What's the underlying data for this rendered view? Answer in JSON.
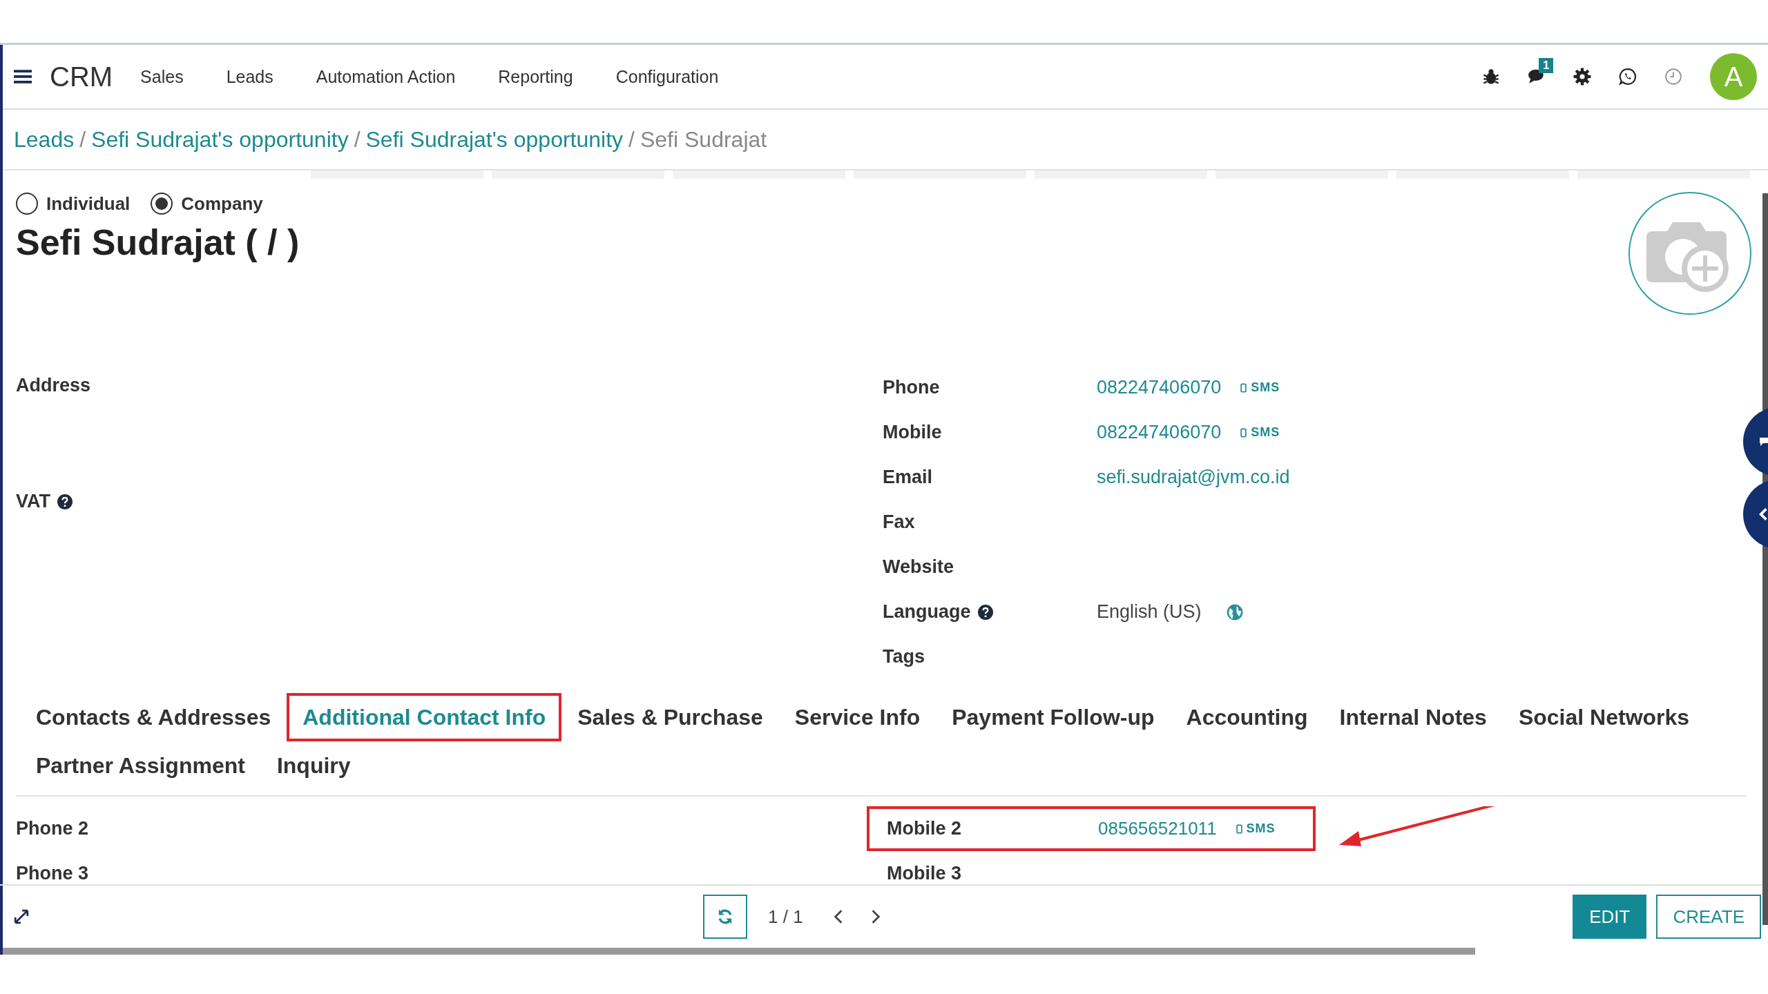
{
  "navbar": {
    "app": "CRM",
    "menu": [
      "Sales",
      "Leads",
      "Automation Action",
      "Reporting",
      "Configuration"
    ],
    "messages_badge": "1",
    "avatar": "A"
  },
  "breadcrumb": {
    "separator": "/",
    "items": [
      {
        "label": "Leads",
        "kind": "link"
      },
      {
        "label": "Sefi Sudrajat's opportunity",
        "kind": "link"
      },
      {
        "label": "Sefi Sudrajat's opportunity",
        "kind": "link"
      },
      {
        "label": "Sefi Sudrajat",
        "kind": "current"
      }
    ]
  },
  "company_type": [
    {
      "label": "Individual",
      "selected": false
    },
    {
      "label": "Company",
      "selected": true
    }
  ],
  "title": "Sefi Sudrajat ( / )",
  "left_fields": [
    {
      "label": "Address",
      "help": false,
      "kind": "address"
    },
    {
      "label": "VAT",
      "help": true,
      "kind": "plain"
    }
  ],
  "right_fields": [
    {
      "label": "Phone",
      "help": false,
      "kind": "phone",
      "value": "082247406070",
      "sms": "SMS"
    },
    {
      "label": "Mobile",
      "help": false,
      "kind": "phone",
      "value": "082247406070",
      "sms": "SMS"
    },
    {
      "label": "Email",
      "help": false,
      "kind": "email",
      "value": "sefi.sudrajat@jvm.co.id"
    },
    {
      "label": "Fax",
      "help": false,
      "kind": "empty"
    },
    {
      "label": "Website",
      "help": false,
      "kind": "empty"
    },
    {
      "label": "Language",
      "help": true,
      "kind": "language",
      "value": "English (US)"
    },
    {
      "label": "Tags",
      "help": false,
      "kind": "empty"
    }
  ],
  "tabs": [
    {
      "label": "Contacts & Addresses",
      "selected": false,
      "highlighted": false
    },
    {
      "label": "Additional Contact Info",
      "selected": true,
      "highlighted": true
    },
    {
      "label": "Sales & Purchase",
      "selected": false,
      "highlighted": false
    },
    {
      "label": "Service Info",
      "selected": false,
      "highlighted": false
    },
    {
      "label": "Payment Follow-up",
      "selected": false,
      "highlighted": false
    },
    {
      "label": "Accounting",
      "selected": false,
      "highlighted": false
    },
    {
      "label": "Internal Notes",
      "selected": false,
      "highlighted": false
    },
    {
      "label": "Social Networks",
      "selected": false,
      "highlighted": false
    },
    {
      "label": "Partner Assignment",
      "selected": false,
      "highlighted": false
    },
    {
      "label": "Inquiry",
      "selected": false,
      "highlighted": false
    }
  ],
  "tab_fields": {
    "left": [
      {
        "label": "Phone 2"
      },
      {
        "label": "Phone 3"
      }
    ],
    "right": [
      {
        "label": "Mobile 2",
        "value": "085656521011",
        "sms": "SMS",
        "highlighted": true
      },
      {
        "label": "Mobile 3",
        "highlighted": false
      }
    ]
  },
  "pager": "1 / 1",
  "buttons": [
    {
      "label": "EDIT",
      "kind": "primary"
    },
    {
      "label": "CREATE",
      "kind": "secondary"
    }
  ]
}
